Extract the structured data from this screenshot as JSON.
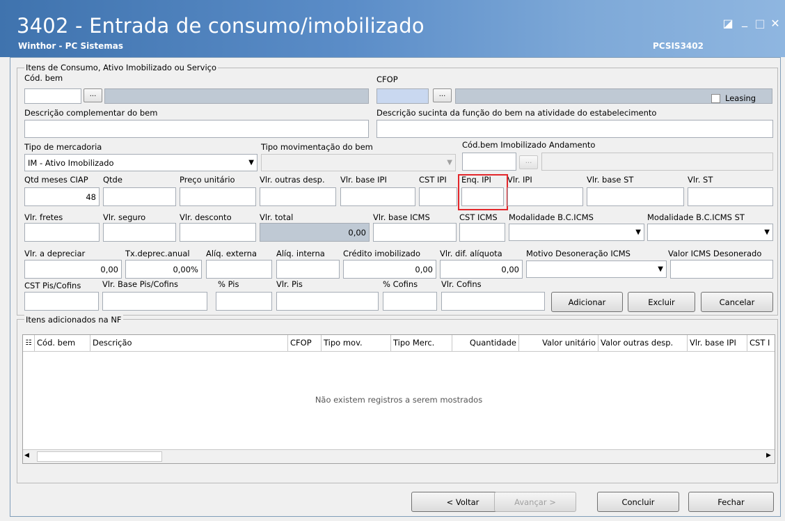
{
  "window": {
    "title": "3402 - Entrada de consumo/imobilizado",
    "company": "Winthor - PC Sistemas",
    "code": "PCSIS3402",
    "controls": {
      "restore": "◪",
      "minimize": "_",
      "maximize": "□",
      "close": "✕"
    }
  },
  "items_group": {
    "legend": "Itens de Consumo,  Ativo Imobilizado ou Serviço",
    "cod_bem_label": "Cód. bem",
    "cfop_label": "CFOP",
    "dots": "...",
    "leasing_label": "Leasing",
    "desc_comp_label": "Descrição complementar do bem",
    "desc_sucinta_label": "Descrição sucinta da função do bem na atividade do estabelecimento",
    "tipo_merc_label": "Tipo de mercadoria",
    "tipo_merc_value": "IM - Ativo Imobilizado",
    "tipo_mov_label": "Tipo movimentação do bem",
    "cod_andamento_label": "Cód.bem Imobilizado Andamento",
    "row4_labels": {
      "qtd_meses": "Qtd meses CIAP",
      "qtde": "Qtde",
      "preco": "Preço unitário",
      "outras": "Vlr. outras desp.",
      "base_ipi": "Vlr. base IPI",
      "cst_ipi": "CST IPI",
      "enq_ipi": "Enq. IPI",
      "vlr_ipi": "Vlr. IPI",
      "base_st": "Vlr. base ST",
      "vlr_st": "Vlr. ST"
    },
    "qtd_meses_value": "48",
    "row5_labels": {
      "fretes": "Vlr. fretes",
      "seguro": "Vlr. seguro",
      "desconto": "Vlr. desconto",
      "total": "Vlr. total",
      "base_icms": "Vlr. base ICMS",
      "cst_icms": "CST ICMS",
      "modalidade": "Modalidade B.C.ICMS",
      "modalidade_st": "Modalidade B.C.ICMS ST"
    },
    "total_value": "0,00",
    "row6_labels": {
      "depreciar": "Vlr. a depreciar",
      "tx": "Tx.deprec.anual",
      "aliq_ext": "Alíq. externa",
      "aliq_int": "Alíq. interna",
      "credito": "Crédito imobilizado",
      "dif": "Vlr. dif. alíquota",
      "motivo": "Motivo Desoneração ICMS",
      "desonerado": "Valor ICMS Desonerado"
    },
    "depreciar_value": "0,00",
    "tx_value": "0,00%",
    "credito_value": "0,00",
    "dif_value": "0,00",
    "row7_labels": {
      "cst_pis": "CST Pis/Cofins",
      "base_pis": "Vlr. Base Pis/Cofins",
      "pct_pis": "% Pis",
      "vlr_pis": "Vlr. Pis",
      "pct_cofins": "% Cofins",
      "vlr_cofins": "Vlr. Cofins"
    },
    "buttons": {
      "adicionar": "Adicionar",
      "excluir": "Excluir",
      "cancelar": "Cancelar"
    }
  },
  "added_group": {
    "legend": "Itens adicionados na NF",
    "columns": [
      "Cód. bem",
      "Descrição",
      "CFOP",
      "Tipo mov.",
      "Tipo Merc.",
      "Quantidade",
      "Valor unitário",
      "Valor outras desp.",
      "Vlr. base IPI",
      "CST I"
    ],
    "empty_message": "Não existem registros a serem mostrados"
  },
  "footer": {
    "voltar": "< Voltar",
    "avancar": "Avançar >",
    "concluir": "Concluir",
    "fechar": "Fechar"
  },
  "colors": {
    "titlebar": "#4f80bb",
    "highlight": "#e3262a",
    "readonly": "#bfc9d4"
  }
}
